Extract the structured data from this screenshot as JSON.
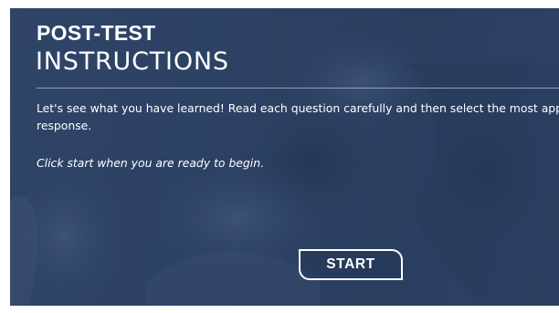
{
  "title": {
    "line1": "POST-TEST",
    "line2": "INSTRUCTIONS"
  },
  "instructions": {
    "line1": "Let's see what you have learned! Read each question carefully and then select the most appropriate",
    "line2": "response."
  },
  "prompt": "Click start when you are ready to begin.",
  "start_button": {
    "label": "START"
  },
  "colors": {
    "background": "#2d4266",
    "text": "#ffffff",
    "rule": "#8fa2bf"
  }
}
